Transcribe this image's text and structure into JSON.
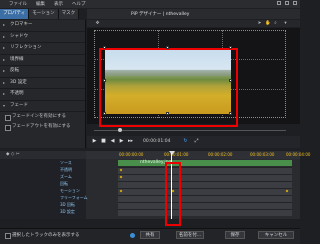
{
  "menu": [
    "ファイル",
    "編集",
    "表示",
    "ヘルプ"
  ],
  "left_tabs": [
    "プロパティ",
    "モーション",
    "マスク"
  ],
  "left_items": [
    "クロマキー",
    "シャドウ",
    "リフレクション",
    "境界線",
    "反転",
    "3D 設定",
    "不透明",
    "フェード"
  ],
  "left_checks": [
    "フェードインを有効にする",
    "フェードアウトを有効にする"
  ],
  "window_title": "PiP デザイナー  |  nthevalley",
  "timecode": "00:00:01:04",
  "ruler_ticks": [
    "00:00:00:00",
    "00:00:01:00",
    "00:00:02:00",
    "00:00:03:00",
    "00:00:04:00"
  ],
  "clip_name": "nthevalley.jpg",
  "track_labels": [
    "ソース",
    "不透明",
    "ズーム",
    "回転",
    "モーション",
    "フリーフォーム",
    "3D 回転",
    "3D 設定"
  ],
  "bottom_check": "選択したトラックのみを表示する",
  "buttons": {
    "share": "共有",
    "save_as": "名前を付...",
    "save": "保存",
    "cancel": "キャンセル"
  },
  "colors": {
    "accent": "#3a6ea5",
    "clip": "#4a8e4c",
    "highlight": "#e00000",
    "keyframe": "#e0b400"
  }
}
